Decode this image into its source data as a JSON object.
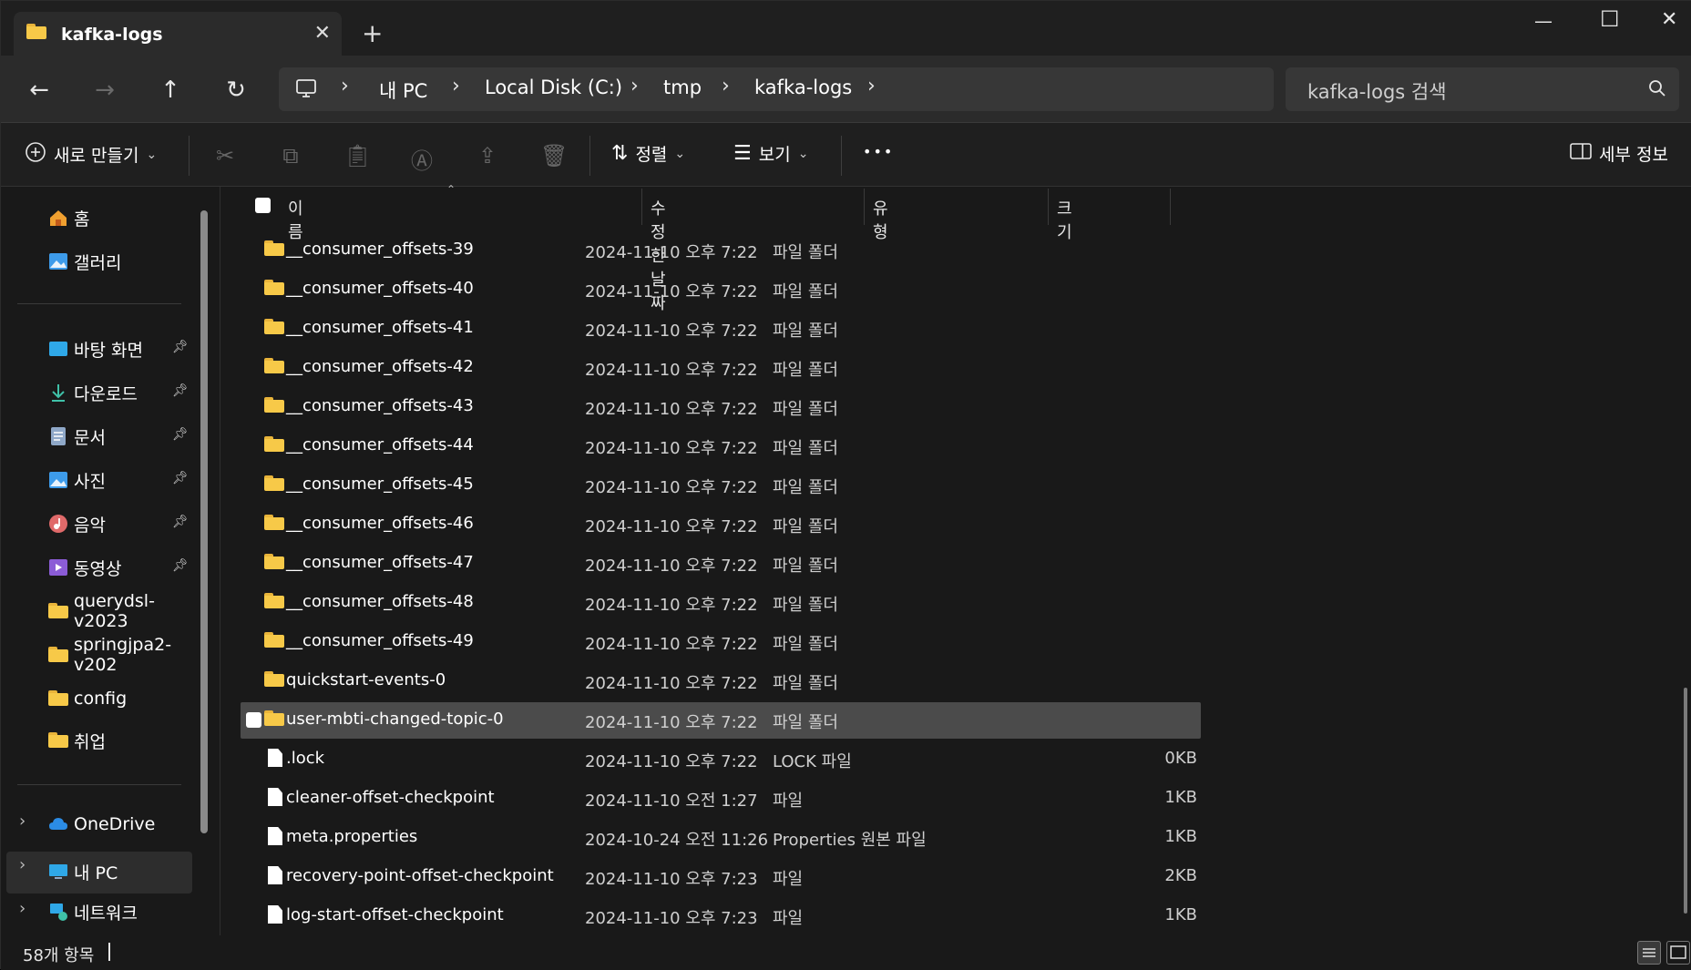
{
  "window": {
    "tab_title": "kafka-logs",
    "tab_close": "✕",
    "new_tab": "+",
    "minimize": "—",
    "maximize": "☐",
    "close": "✕"
  },
  "nav": {
    "back": "←",
    "forward": "→",
    "up": "↑",
    "refresh": "↻",
    "breadcrumb": [
      "내 PC",
      "Local Disk (C:)",
      "tmp",
      "kafka-logs"
    ],
    "search_placeholder": "kafka-logs 검색"
  },
  "toolbar": {
    "new_label": "새로 만들기",
    "sort_label": "정렬",
    "view_label": "보기",
    "more_label": "•••",
    "details_label": "세부 정보"
  },
  "sidebar": {
    "home": "홈",
    "gallery": "갤러리",
    "desktop": "바탕 화면",
    "downloads": "다운로드",
    "documents": "문서",
    "pictures": "사진",
    "music": "음악",
    "videos": "동영상",
    "folder1": "querydsl-v2023",
    "folder2": "springjpa2-v202",
    "folder3": "config",
    "folder4": "취업",
    "onedrive": "OneDrive",
    "thispc": "내 PC",
    "network": "네트워크",
    "expand": "›"
  },
  "columns": {
    "name": "이름",
    "modified": "수정한 날짜",
    "type": "유형",
    "size": "크기"
  },
  "rows": [
    {
      "name": "__consumer_offsets-39",
      "date": "2024-11-10 오후 7:22",
      "type": "파일 폴더",
      "size": "",
      "kind": "folder"
    },
    {
      "name": "__consumer_offsets-40",
      "date": "2024-11-10 오후 7:22",
      "type": "파일 폴더",
      "size": "",
      "kind": "folder"
    },
    {
      "name": "__consumer_offsets-41",
      "date": "2024-11-10 오후 7:22",
      "type": "파일 폴더",
      "size": "",
      "kind": "folder"
    },
    {
      "name": "__consumer_offsets-42",
      "date": "2024-11-10 오후 7:22",
      "type": "파일 폴더",
      "size": "",
      "kind": "folder"
    },
    {
      "name": "__consumer_offsets-43",
      "date": "2024-11-10 오후 7:22",
      "type": "파일 폴더",
      "size": "",
      "kind": "folder"
    },
    {
      "name": "__consumer_offsets-44",
      "date": "2024-11-10 오후 7:22",
      "type": "파일 폴더",
      "size": "",
      "kind": "folder"
    },
    {
      "name": "__consumer_offsets-45",
      "date": "2024-11-10 오후 7:22",
      "type": "파일 폴더",
      "size": "",
      "kind": "folder"
    },
    {
      "name": "__consumer_offsets-46",
      "date": "2024-11-10 오후 7:22",
      "type": "파일 폴더",
      "size": "",
      "kind": "folder"
    },
    {
      "name": "__consumer_offsets-47",
      "date": "2024-11-10 오후 7:22",
      "type": "파일 폴더",
      "size": "",
      "kind": "folder"
    },
    {
      "name": "__consumer_offsets-48",
      "date": "2024-11-10 오후 7:22",
      "type": "파일 폴더",
      "size": "",
      "kind": "folder"
    },
    {
      "name": "__consumer_offsets-49",
      "date": "2024-11-10 오후 7:22",
      "type": "파일 폴더",
      "size": "",
      "kind": "folder"
    },
    {
      "name": "quickstart-events-0",
      "date": "2024-11-10 오후 7:22",
      "type": "파일 폴더",
      "size": "",
      "kind": "folder"
    },
    {
      "name": "user-mbti-changed-topic-0",
      "date": "2024-11-10 오후 7:22",
      "type": "파일 폴더",
      "size": "",
      "kind": "folder",
      "selected": true
    },
    {
      "name": ".lock",
      "date": "2024-11-10 오후 7:22",
      "type": "LOCK 파일",
      "size": "0KB",
      "kind": "file"
    },
    {
      "name": "cleaner-offset-checkpoint",
      "date": "2024-11-10 오전 1:27",
      "type": "파일",
      "size": "1KB",
      "kind": "file"
    },
    {
      "name": "meta.properties",
      "date": "2024-10-24 오전 11:26",
      "type": "Properties 원본 파일",
      "size": "1KB",
      "kind": "file"
    },
    {
      "name": "recovery-point-offset-checkpoint",
      "date": "2024-11-10 오후 7:23",
      "type": "파일",
      "size": "2KB",
      "kind": "file"
    },
    {
      "name": "log-start-offset-checkpoint",
      "date": "2024-11-10 오후 7:23",
      "type": "파일",
      "size": "1KB",
      "kind": "file"
    }
  ],
  "status": {
    "count": "58개 항목"
  },
  "colors": {
    "folder": "#f7c948",
    "selected_row": "#4b4b4b",
    "background": "#191919"
  }
}
